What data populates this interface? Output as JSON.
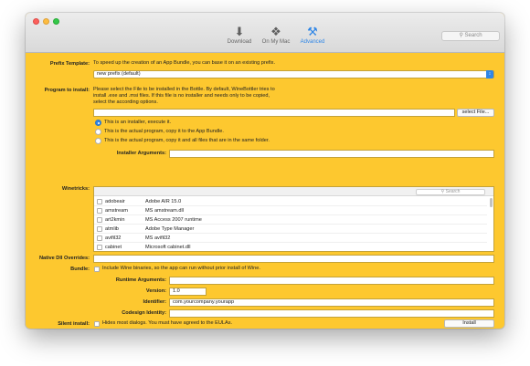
{
  "toolbar": {
    "download": "Download",
    "on_my_mac": "On My Mac",
    "advanced": "Advanced",
    "search_placeholder": "Search"
  },
  "prefix": {
    "label": "Prefix Template:",
    "description": "To speed up the creation of an App Bundle, you can base it on an existing prefix.",
    "selected": "new prefix (default)"
  },
  "program": {
    "label": "Program to install:",
    "description_line1": "Please select the File to be installed in the Bottle. By default, WineBottler tries to",
    "description_line2": "install .exe and .msi files. If this file is no installer and needs only to be copied,",
    "description_line3": "select the according options.",
    "file_value": "",
    "select_file_label": "select File...",
    "options": [
      "This is an installer, execute it.",
      "This is the actual program, copy it to the App Bundle.",
      "This is the actual program, copy it and all files that are in the same folder."
    ],
    "installer_args_label": "Installer Arguments:",
    "installer_args_value": ""
  },
  "winetricks": {
    "label": "Winetricks:",
    "search_placeholder": "Search",
    "items": [
      {
        "name": "adobeair",
        "desc": "Adobe AIR 15.0"
      },
      {
        "name": "amstream",
        "desc": "MS amstream.dll"
      },
      {
        "name": "art2kmin",
        "desc": "MS Access 2007 runtime"
      },
      {
        "name": "atmlib",
        "desc": "Adobe Type Manager"
      },
      {
        "name": "avifil32",
        "desc": "MS avifil32"
      },
      {
        "name": "cabinet",
        "desc": "Microsoft cabinet.dll"
      }
    ]
  },
  "native_dll": {
    "label": "Native Dll Overrides:",
    "value": ""
  },
  "bundle": {
    "label": "Bundle:",
    "checkbox_text": "Include Wine binaries, so the app can run without prior install of Wine.",
    "runtime_args_label": "Runtime Arguments:",
    "runtime_args_value": "",
    "version_label": "Version:",
    "version_value": "1.0",
    "identifier_label": "Identifier:",
    "identifier_value": "com.yourcompany.yourapp",
    "codesign_label": "Codesign Identity:",
    "codesign_value": ""
  },
  "silent": {
    "label": "Silent install:",
    "checkbox_text": "Hides most dialogs. You must have agreed to the EULAs.",
    "install_label": "Install"
  }
}
